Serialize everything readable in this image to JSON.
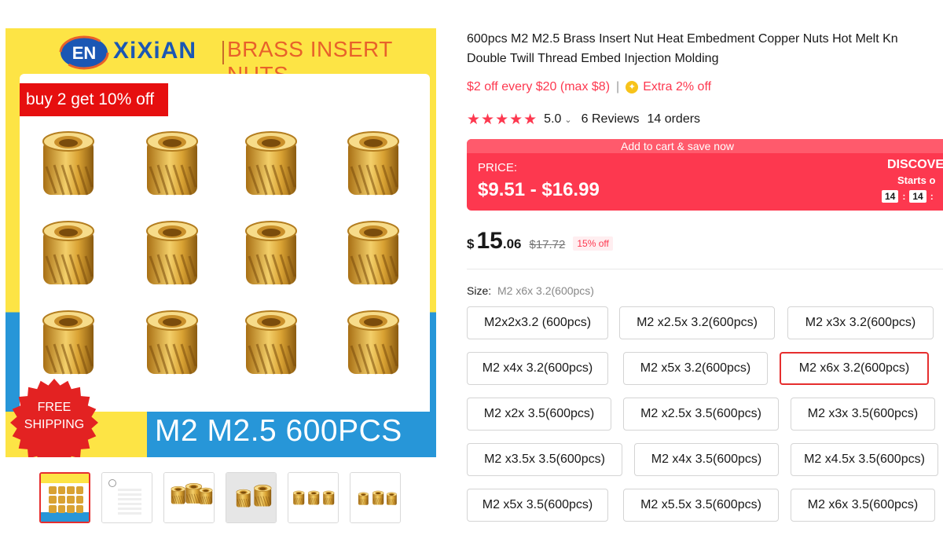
{
  "gallery": {
    "brand_logo_text": "EN",
    "brand_name": "XiXiAN",
    "brand_tagline": "BRASS INSERT NUTS",
    "promo_badge": "buy 2 get 10% off",
    "shipping_badge": "FREE SHIPPING",
    "bottom_caption": "M2 M2.5   600PCS",
    "thumbnails": [
      {
        "name": "thumb-1",
        "active": true
      },
      {
        "name": "thumb-2",
        "active": false
      },
      {
        "name": "thumb-3",
        "active": false
      },
      {
        "name": "thumb-4",
        "active": false
      },
      {
        "name": "thumb-5",
        "active": false
      },
      {
        "name": "thumb-6",
        "active": false
      }
    ]
  },
  "product": {
    "title_line1": "600pcs M2 M2.5 Brass Insert Nut Heat Embedment Copper Nuts Hot Melt Kn",
    "title_line2": "Double Twill Thread Embed Injection Molding",
    "coupon": "$2 off every $20 (max $8)",
    "coupon_separator": "|",
    "coin_icon": "coin-icon",
    "extra_off": "Extra 2% off",
    "stars": "★★★★★",
    "rating": "5.0",
    "reviews": "6 Reviews",
    "orders": "14 orders"
  },
  "price_banner": {
    "top_text": "Add to cart & save now",
    "label": "PRICE:",
    "range": "$9.51 - $16.99",
    "discover": "DISCOVE",
    "starts": "Starts o",
    "timer": [
      "14",
      "14"
    ],
    "timer_separator": ":"
  },
  "price": {
    "currency": "$",
    "integer": "15",
    "decimal": ".06",
    "original": "$17.72",
    "discount": "15% off"
  },
  "size": {
    "label": "Size:",
    "selected": "M2 x6x 3.2(600pcs)",
    "options": [
      "M2x2x3.2 (600pcs)",
      "M2 x2.5x 3.2(600pcs)",
      "M2 x3x 3.2(600pcs)",
      "M2 x4x 3.2(600pcs)",
      "M2 x5x 3.2(600pcs)",
      "M2 x6x 3.2(600pcs)",
      "M2 x2x 3.5(600pcs)",
      "M2 x2.5x 3.5(600pcs)",
      "M2 x3x 3.5(600pcs)",
      "M2 x3.5x 3.5(600pcs)",
      "M2 x4x 3.5(600pcs)",
      "M2 x4.5x 3.5(600pcs)",
      "M2 x5x 3.5(600pcs)",
      "M2 x5.5x 3.5(600pcs)",
      "M2 x6x 3.5(600pcs)"
    ]
  },
  "colors": {
    "accent_red": "#fd384f",
    "selected_border": "#e62e2e",
    "brand_blue": "#1b57b4",
    "banner_yellow": "#fde445",
    "banner_blue": "#2796d8"
  }
}
